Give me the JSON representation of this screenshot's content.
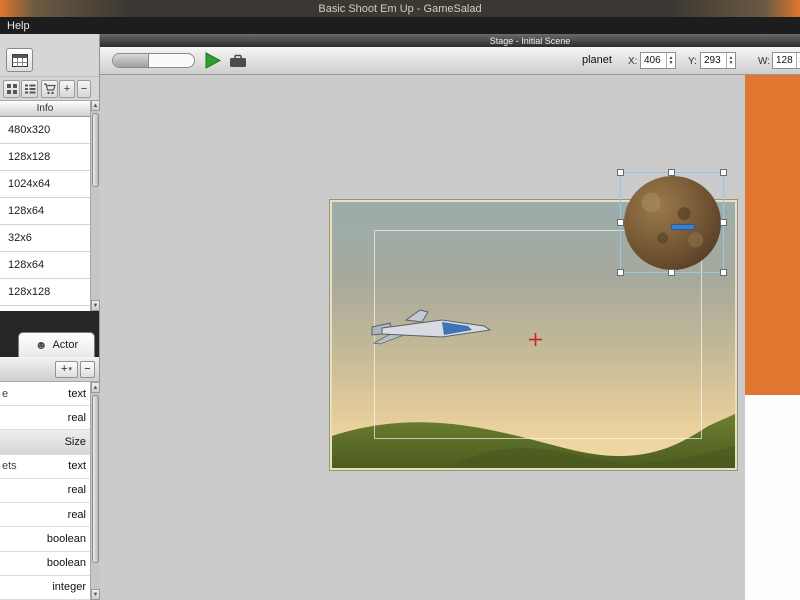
{
  "window": {
    "title": "Basic Shoot Em Up - GameSalad",
    "menu": [
      "Help"
    ]
  },
  "library": {
    "column_header": "Info",
    "add_label": "+",
    "remove_label": "−",
    "items": [
      "480x320",
      "128x128",
      "1024x64",
      "128x64",
      "32x6",
      "128x64",
      "128x128"
    ]
  },
  "actor_panel": {
    "tab_label": "Actor",
    "add_label": "+",
    "remove_label": "−",
    "attributes": [
      {
        "name": "e",
        "type": "text"
      },
      {
        "name": "",
        "type": "real"
      },
      {
        "name": "",
        "type": "Size",
        "group": true
      },
      {
        "name": "ets",
        "type": "text"
      },
      {
        "name": "",
        "type": "real"
      },
      {
        "name": "",
        "type": "real"
      },
      {
        "name": "",
        "type": "boolean"
      },
      {
        "name": "",
        "type": "boolean"
      },
      {
        "name": "",
        "type": "integer"
      }
    ]
  },
  "stage": {
    "header": "Stage - Initial Scene",
    "selected_actor": "planet",
    "x_label": "X:",
    "x_value": "406",
    "y_label": "Y:",
    "y_value": "293",
    "w_label": "W:",
    "w_value": "128"
  },
  "icons": {
    "actor_face": "☻",
    "scroll_up": "▲",
    "scroll_down": "▼",
    "spin_up": "▲",
    "spin_down": "▼",
    "caret_down": "▾"
  },
  "colors": {
    "accent_orange": "#e0762f",
    "play_green": "#2f9e2f",
    "selection_blue": "#9cc4e4",
    "crosshair_red": "#cc2222"
  }
}
